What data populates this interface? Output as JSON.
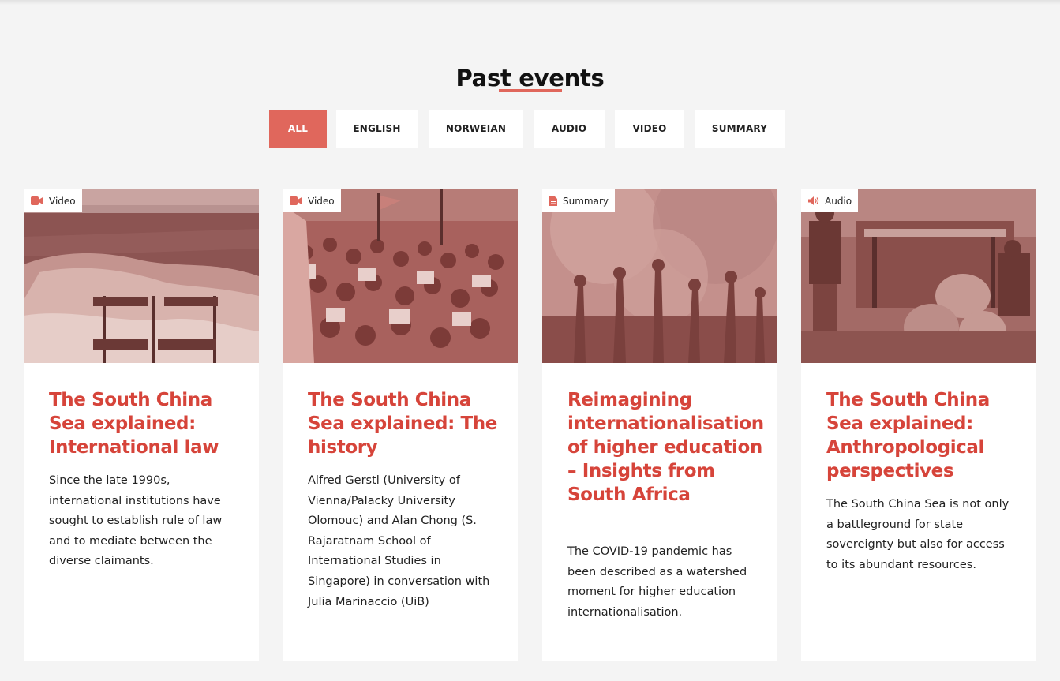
{
  "section": {
    "title": "Past events"
  },
  "filters": [
    {
      "label": "ALL",
      "active": true
    },
    {
      "label": "ENGLISH",
      "active": false
    },
    {
      "label": "NORWEIAN",
      "active": false
    },
    {
      "label": "AUDIO",
      "active": false
    },
    {
      "label": "VIDEO",
      "active": false
    },
    {
      "label": "SUMMARY",
      "active": false
    }
  ],
  "colors": {
    "accent": "#e0675c",
    "title_red": "#d6443a",
    "background": "#f4f4f4"
  },
  "cards": [
    {
      "badge": {
        "label": "Video",
        "icon": "video-camera-icon"
      },
      "image": "coastline-with-south-china-sea-signpost",
      "title": "The South China Sea explained: International law",
      "description": "Since the late 1990s, international institutions have sought to establish rule of law and to mediate between the diverse claimants."
    },
    {
      "badge": {
        "label": "Video",
        "icon": "video-camera-icon"
      },
      "image": "crowd-of-protesters-with-flags",
      "title": "The South China Sea explained: The history",
      "description": "Alfred Gerstl (University of Vienna/Palacky University Olomouc) and Alan Chong (S. Rajaratnam School of International Studies in Singapore) in conversation with Julia Marinaccio (UiB)"
    },
    {
      "badge": {
        "label": "Summary",
        "icon": "document-icon"
      },
      "image": "raised-hands-in-colored-smoke",
      "title": "Reimagining internationalisation of higher education – Insights from South Africa",
      "description": "The COVID-19 pandemic has been described as a watershed moment for higher education internationalisation."
    },
    {
      "badge": {
        "label": "Audio",
        "icon": "speaker-icon"
      },
      "image": "fishermen-on-boat-with-baskets",
      "title": "The South China Sea explained: Anthropological perspectives",
      "description": "The South China Sea is not only a battleground for state sovereignty but also for access to its abundant resources."
    }
  ]
}
